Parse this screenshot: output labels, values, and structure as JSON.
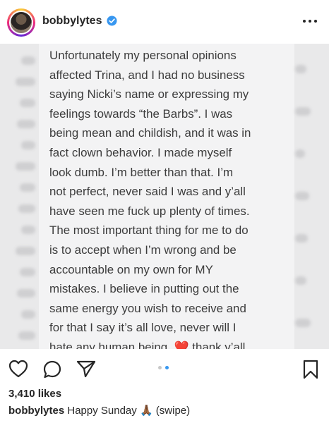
{
  "header": {
    "username": "bobbylytes",
    "verified_color": "#3897f0"
  },
  "post": {
    "text": "Unfortunately my personal opinions\naffected Trina, and I had no business\nsaying Nicki’s name or expressing my\nfeelings towards “the Barbs”. I was\nbeing mean and childish, and it was in\nfact clown behavior. I made myself\nlook dumb. I’m better than that. I’m\nnot perfect, never said I was and y’all\nhave seen me fuck up plenty of times.\nThe most important thing for me to do\nis to accept when I’m wrong and be\naccountable on my own for MY\nmistakes. I believe in putting out the\nsame energy you wish to receive and\nfor that I say it’s all love, never will I\nhate any human being. ",
    "heart_emoji": "❤️",
    "tail": " thank y’all",
    "heart_color": "#e0245e"
  },
  "carousel": {
    "total": 2,
    "active_index": 1,
    "active_color": "#3897f0",
    "inactive_color": "#c7c7c7"
  },
  "stats": {
    "likes": "3,410 likes"
  },
  "caption": {
    "username": "bobbylytes",
    "text": " Happy Sunday ",
    "emoji": "🙏🏾",
    "suffix": " (swipe)"
  },
  "icons": {
    "more": "more-horizontal-icon",
    "like": "heart-outline-icon",
    "comment": "comment-icon",
    "share": "paper-plane-icon",
    "save": "bookmark-icon",
    "verified": "verified-badge-icon"
  }
}
